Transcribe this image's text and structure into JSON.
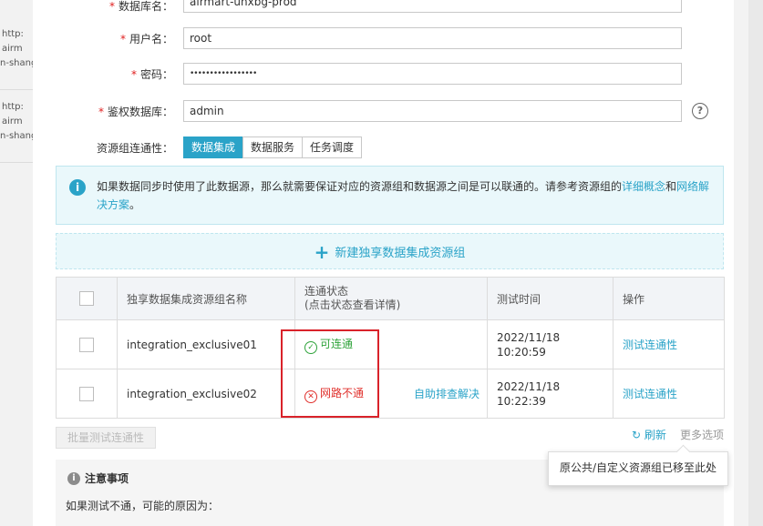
{
  "background": {
    "lines": [
      "http:",
      "airm",
      "n-shang",
      "http:",
      "airm",
      "n-shang"
    ]
  },
  "form": {
    "db_name": {
      "label": "数据库名：",
      "value": "airmart-unxbg-prod"
    },
    "username": {
      "label": "用户名：",
      "value": "root"
    },
    "password": {
      "label": "密码：",
      "value": "•••••••••••••••••"
    },
    "auth_db": {
      "label": "鉴权数据库：",
      "value": "admin"
    },
    "help_glyph": "?",
    "required_mark": "*",
    "connectivity_label": "资源组连通性：",
    "tabs": [
      "数据集成",
      "数据服务",
      "任务调度"
    ]
  },
  "info": {
    "icon_glyph": "i",
    "text": "如果数据同步时使用了此数据源，那么就需要保证对应的资源组和数据源之间是可以联通的。请参考资源组的",
    "link1": "详细概念",
    "and": "和",
    "link2": "网络解决方案",
    "end": "。"
  },
  "add_group": {
    "plus": "+",
    "label": "新建独享数据集成资源组"
  },
  "table": {
    "headers": {
      "name": "独享数据集成资源组名称",
      "status_line1": "连通状态",
      "status_line2": "(点击状态查看详情)",
      "time": "测试时间",
      "action": "操作"
    },
    "rows": [
      {
        "name": "integration_exclusive01",
        "status": "可连通",
        "status_glyph": "✓",
        "extra": "",
        "date": "2022/11/18",
        "time": "10:20:59",
        "action": "测试连通性"
      },
      {
        "name": "integration_exclusive02",
        "status": "网路不通",
        "status_glyph": "✕",
        "extra": "自助排查解决",
        "date": "2022/11/18",
        "time": "10:22:39",
        "action": "测试连通性"
      }
    ]
  },
  "footer": {
    "batch_button": "批量测试连通性",
    "refresh_glyph": "↻",
    "refresh": "刷新",
    "more": "更多选项",
    "tooltip": "原公共/自定义资源组已移至此处"
  },
  "notice": {
    "icon_glyph": "i",
    "title": "注意事项",
    "body": "如果测试不通，可能的原因为："
  },
  "colors": {
    "accent": "#2aa3c8",
    "success": "#2fa33b",
    "error": "#e0302c",
    "highlight": "#d9222a"
  }
}
